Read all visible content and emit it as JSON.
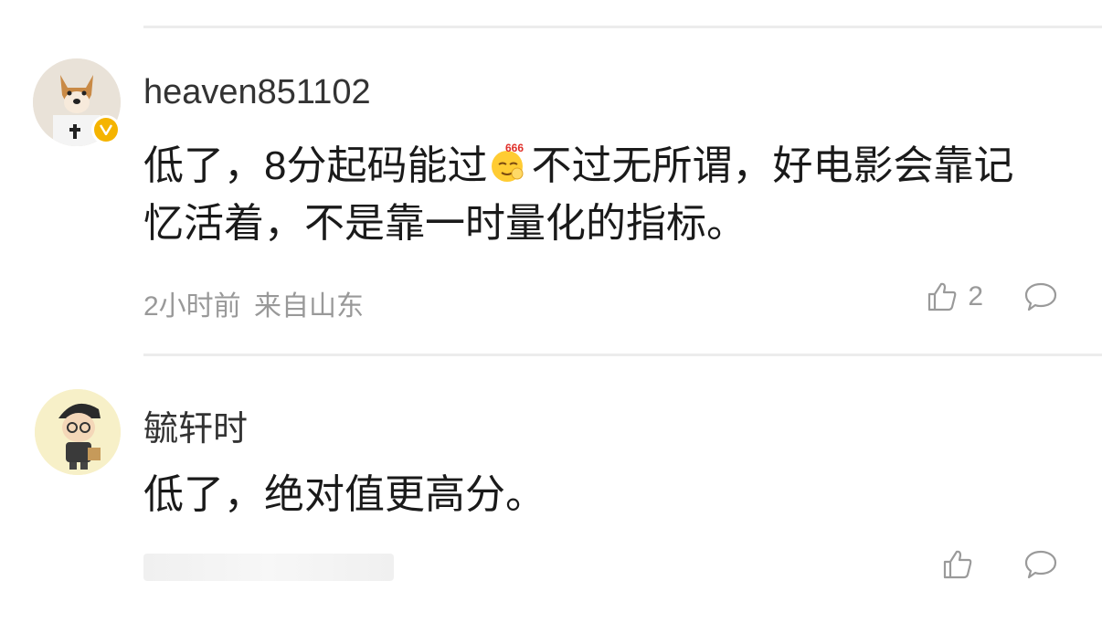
{
  "comments": [
    {
      "username": "heaven851102",
      "verified_badge": "v-verified-icon",
      "text_before_emoji": "低了，8分起码能过",
      "emoji": "666-emoji-icon",
      "emoji_badge_text": "666",
      "text_after_emoji": "不过无所谓，好电影会靠记忆活着，不是靠一时量化的指标。",
      "time": "2小时前",
      "location": "来自山东",
      "like_count": "2"
    },
    {
      "username": "毓轩时",
      "text": "低了，绝对值更高分。"
    }
  ],
  "colors": {
    "divider": "#ececec",
    "verified_badge": "#f5b400",
    "meta_text": "#999999"
  }
}
